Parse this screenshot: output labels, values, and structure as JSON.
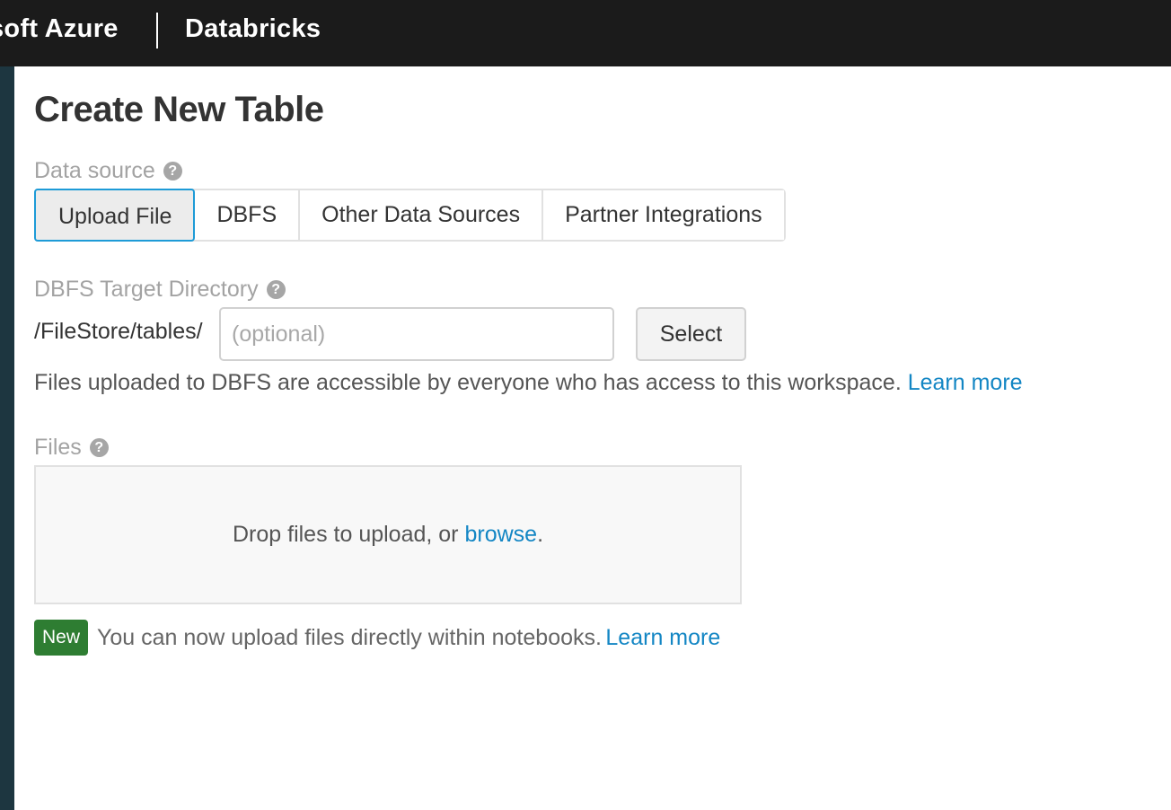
{
  "topbar": {
    "left_brand": "soft Azure",
    "right_brand": "Databricks"
  },
  "page": {
    "title": "Create New Table"
  },
  "data_source": {
    "label": "Data source",
    "tabs": [
      {
        "label": "Upload File",
        "active": true
      },
      {
        "label": "DBFS",
        "active": false
      },
      {
        "label": "Other Data Sources",
        "active": false
      },
      {
        "label": "Partner Integrations",
        "active": false
      }
    ]
  },
  "target_dir": {
    "label": "DBFS Target Directory",
    "prefix": "/FileStore/tables/",
    "value": "",
    "placeholder": "(optional)",
    "select_label": "Select",
    "info_text": "Files uploaded to DBFS are accessible by everyone who has access to this workspace.",
    "learn_more": "Learn more"
  },
  "files": {
    "label": "Files",
    "drop_text": "Drop files to upload, or",
    "browse_link": "browse",
    "drop_suffix": "."
  },
  "notice": {
    "badge": "New",
    "text": "You can now upload files directly within notebooks.",
    "learn_more": "Learn more"
  },
  "icons": {
    "help": "question-circle-icon"
  },
  "colors": {
    "topbar_bg": "#1b1b1b",
    "sidebar_bg": "#1d3640",
    "active_tab_border": "#1e9bd7",
    "link": "#1386c4",
    "badge_bg": "#2e7d32"
  }
}
